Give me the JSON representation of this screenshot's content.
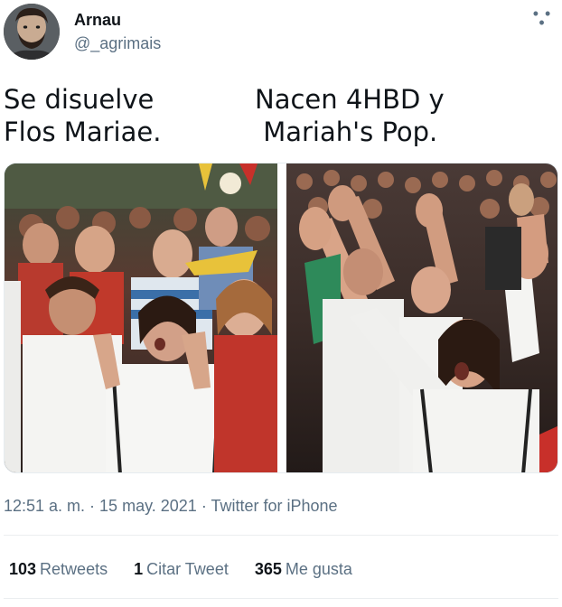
{
  "tweet": {
    "author": {
      "name": "Arnau",
      "handle": "@_agrimais"
    },
    "more_icon": "more-horizontal-icon",
    "text_left": [
      "Se disuelve",
      "Flos Mariae."
    ],
    "text_right": [
      "Nacen 4HBD y",
      " Mariah's Pop."
    ],
    "timestamp": "12:51 a. m. · 15 may. 2021",
    "source": "Twitter for iPhone",
    "stats": {
      "retweets_count": "103",
      "retweets_label": "Retweets",
      "quotes_count": "1",
      "quotes_label": "Citar Tweet",
      "likes_count": "365",
      "likes_label": "Me gusta"
    }
  },
  "colors": {
    "text_primary": "#0f1419",
    "text_secondary": "#5b7083",
    "divider": "#ebeef0"
  }
}
